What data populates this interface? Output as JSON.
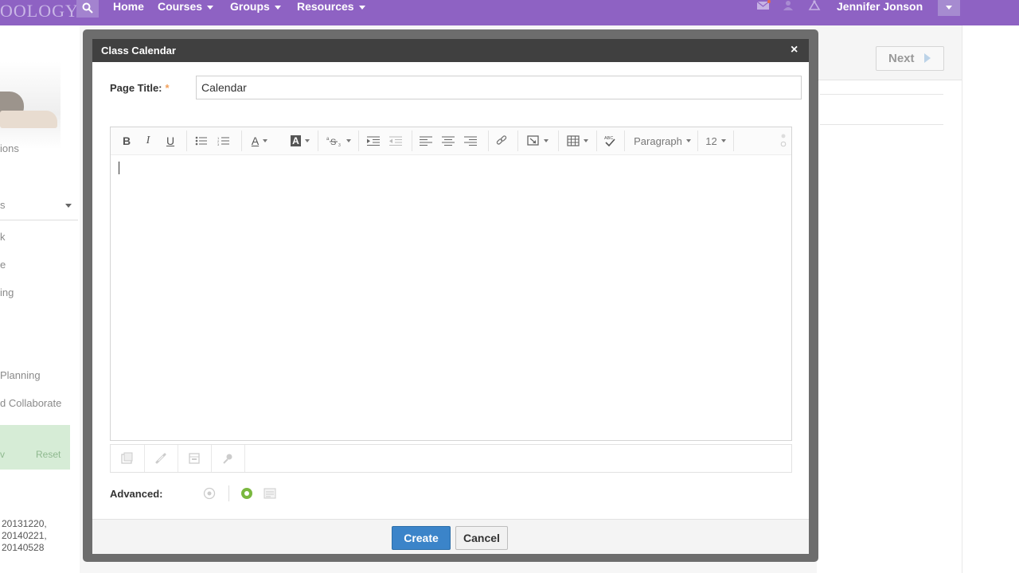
{
  "app": {
    "logo_text": "OOLOGY"
  },
  "nav": {
    "items": [
      {
        "label": "Home"
      },
      {
        "label": "Courses"
      },
      {
        "label": "Groups"
      },
      {
        "label": "Resources"
      }
    ],
    "user_name": "Jennifer Jonson"
  },
  "sidebar": {
    "texts": [
      "ions",
      "s",
      "k",
      "e",
      "ing",
      "Planning",
      "d Collaborate"
    ],
    "panel": {
      "left": "v",
      "right": "Reset"
    },
    "dates": [
      "20131220,",
      "20140221,",
      "20140528"
    ]
  },
  "right": {
    "next_label": "Next"
  },
  "modal": {
    "title": "Class Calendar",
    "close_glyph": "×",
    "page_title_label": "Page Title:",
    "required_mark": "*",
    "page_title_value": "Calendar",
    "toolbar": {
      "bold": "B",
      "italic": "I",
      "underline": "U",
      "font_color": "A",
      "bg_color": "A",
      "format_select": "Paragraph",
      "size_select": "12"
    },
    "advanced_label": "Advanced:",
    "create_label": "Create",
    "cancel_label": "Cancel"
  },
  "colors": {
    "nav_bg": "#8e62c3",
    "primary_button": "#3b84c9",
    "modal_header": "#404040",
    "required": "#f2a05b"
  }
}
